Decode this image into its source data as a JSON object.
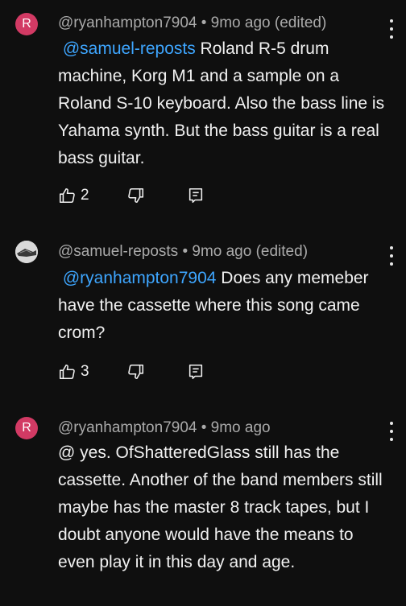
{
  "comments": [
    {
      "avatar_letter": "R",
      "avatar_color": "#d23a64",
      "meta": "@ryanhampton7904 • 9mo ago (edited)",
      "mention": "@samuel-reposts",
      "text": " Roland R-5 drum machine, Korg M1 and a sample on a Roland S-10 keyboard. Also the bass line is  Yahama synth. But the bass guitar is a real bass guitar.",
      "likes": "2"
    },
    {
      "avatar_letter": "",
      "meta": "@samuel-reposts • 9mo ago (edited)",
      "mention": "@ryanhampton7904",
      "text": " Does any memeber have the cassette where this song came crom?",
      "likes": "3"
    },
    {
      "avatar_letter": "R",
      "avatar_color": "#d23a64",
      "meta": "@ryanhampton7904 • 9mo ago",
      "mention": "",
      "text": "@ yes. OfShatteredGlass still has the cassette. Another of the band members still maybe has the master 8 track tapes, but I doubt anyone would have the means to even play it in this day and age."
    }
  ],
  "icons": {
    "like": "thumb-up-icon",
    "dislike": "thumb-down-icon",
    "reply": "reply-icon",
    "menu": "more-vert-icon"
  },
  "colors": {
    "background": "#0f0f0f",
    "mention": "#3ea6ff",
    "meta": "#aaaaaa"
  }
}
